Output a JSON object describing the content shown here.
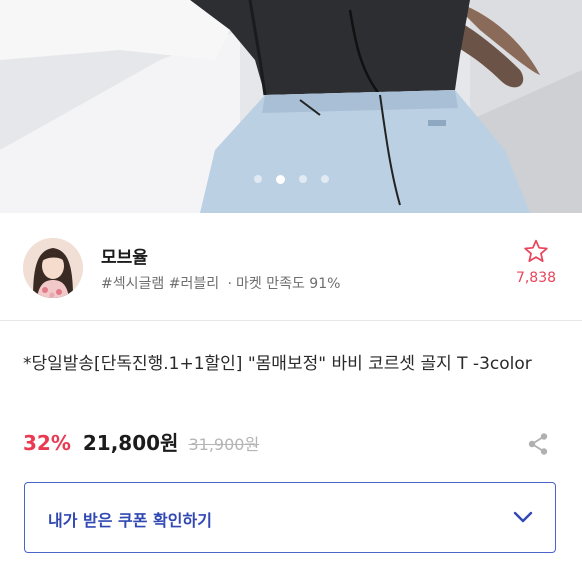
{
  "hero": {
    "slide_count": 4,
    "active_slide": 2
  },
  "shop": {
    "name": "모브율",
    "tags": [
      "#섹시글램",
      "#러블리"
    ],
    "separator": "·",
    "satisfaction": "마켓 만족도 91%",
    "favorite_icon": "star-outline-icon",
    "favorite_count": "7,838"
  },
  "product": {
    "title": "*당일발송[단독진행.1+1할인] \"몸매보정\" 바비 코르셋 골지 T -3color",
    "discount": "32%",
    "price": "21,800원",
    "original_price": "31,900원",
    "share_icon": "share-icon"
  },
  "coupon": {
    "label": "내가 받은 쿠폰 확인하기",
    "chevron_icon": "chevron-down-icon"
  },
  "colors": {
    "accent_red": "#ea3a52",
    "coupon_blue": "#3148b3",
    "muted_text": "#6e6e6e"
  }
}
